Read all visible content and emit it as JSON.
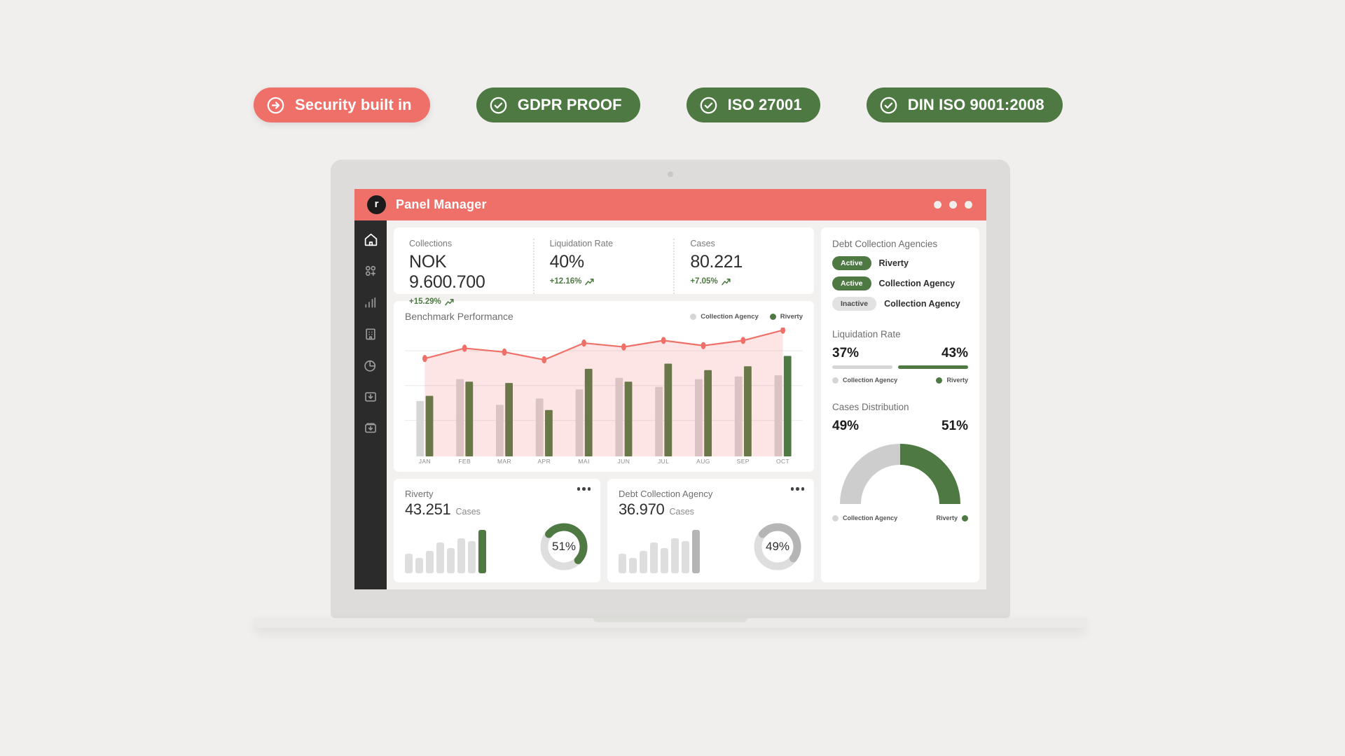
{
  "badges": [
    {
      "label": "Security built in",
      "style": "red",
      "icon": "arrow-right-circle-icon"
    },
    {
      "label": "GDPR PROOF",
      "style": "green",
      "icon": "check-circle-icon"
    },
    {
      "label": "ISO 27001",
      "style": "green",
      "icon": "check-circle-icon"
    },
    {
      "label": "DIN ISO 9001:2008",
      "style": "green",
      "icon": "check-circle-icon"
    }
  ],
  "window": {
    "title": "Panel Manager",
    "logo_letter": "r",
    "accent_color": "#ee7068",
    "green_color": "#4e7942",
    "grey_color": "#d6d6d6"
  },
  "nav": {
    "items": [
      {
        "icon": "home-icon",
        "active": true
      },
      {
        "icon": "add-apps-icon",
        "active": false
      },
      {
        "icon": "bar-chart-icon",
        "active": false
      },
      {
        "icon": "building-icon",
        "active": false
      },
      {
        "icon": "pie-chart-icon",
        "active": false
      },
      {
        "icon": "download-box-icon",
        "active": false
      },
      {
        "icon": "download-stack-icon",
        "active": false
      }
    ]
  },
  "kpis": [
    {
      "label": "Collections",
      "value": "NOK 9.600.700",
      "delta": "+15.29%"
    },
    {
      "label": "Liquidation Rate",
      "value": "40%",
      "delta": "+12.16%"
    },
    {
      "label": "Cases",
      "value": "80.221",
      "delta": "+7.05%"
    }
  ],
  "benchmark": {
    "title": "Benchmark Performance",
    "legend": [
      {
        "label": "Collection Agency",
        "color": "#d6d6d6"
      },
      {
        "label": "Riverty",
        "color": "#4e7942"
      }
    ]
  },
  "chart_data": {
    "type": "bar",
    "title": "Benchmark Performance",
    "xlabel": "",
    "ylabel": "",
    "categories": [
      "JAN",
      "FEB",
      "MAR",
      "APR",
      "MAI",
      "JUN",
      "JUL",
      "AUG",
      "SEP",
      "OCT"
    ],
    "ylim": [
      0,
      100
    ],
    "grid": true,
    "legend_position": "top-right",
    "series": [
      {
        "name": "Collection Agency",
        "type": "bar",
        "color": "#d6d6d6",
        "values": [
          43,
          60,
          40,
          45,
          52,
          61,
          54,
          60,
          62,
          63
        ]
      },
      {
        "name": "Riverty",
        "type": "bar",
        "color": "#4e7942",
        "values": [
          47,
          58,
          57,
          36,
          68,
          58,
          72,
          67,
          70,
          78
        ]
      },
      {
        "name": "Trend",
        "type": "line",
        "color": "#ee7068",
        "values": [
          76,
          84,
          81,
          75,
          88,
          85,
          90,
          86,
          90,
          98
        ]
      }
    ]
  },
  "cards": [
    {
      "title": "Riverty",
      "value": "43.251",
      "unit": "Cases",
      "donut_percent": "51%",
      "donut_value": 51,
      "donut_color": "#4e7942",
      "spark": [
        28,
        22,
        32,
        44,
        36,
        50,
        46,
        62
      ],
      "spark_highlight_color": "#4e7942",
      "spark_base_color": "#dedede",
      "menu_icon": "more-options-icon"
    },
    {
      "title": "Debt Collection Agency",
      "value": "36.970",
      "unit": "Cases",
      "donut_percent": "49%",
      "donut_value": 49,
      "donut_color": "#b5b5b5",
      "spark": [
        28,
        22,
        32,
        44,
        36,
        50,
        46,
        62
      ],
      "spark_highlight_color": "#b5b5b5",
      "spark_base_color": "#dedede",
      "menu_icon": "more-options-icon"
    }
  ],
  "panel": {
    "agencies_title": "Debt Collection Agencies",
    "agencies": [
      {
        "status": "Active",
        "name": "Riverty",
        "active": true
      },
      {
        "status": "Active",
        "name": "Collection Agency",
        "active": true
      },
      {
        "status": "Inactive",
        "name": "Collection Agency",
        "active": false
      }
    ],
    "liquidation": {
      "title": "Liquidation Rate",
      "left_pct": "37%",
      "right_pct": "43%",
      "left_value": 37,
      "right_value": 43,
      "legend": [
        {
          "label": "Collection Agency",
          "color": "#d6d6d6"
        },
        {
          "label": "Riverty",
          "color": "#4e7942"
        }
      ]
    },
    "distribution": {
      "title": "Cases Distribution",
      "left_pct": "49%",
      "right_pct": "51%",
      "left_value": 49,
      "right_value": 51,
      "legend": [
        {
          "label": "Collection Agency",
          "color": "#cdcdcd"
        },
        {
          "label": "Riverty",
          "color": "#4e7942"
        }
      ]
    }
  }
}
